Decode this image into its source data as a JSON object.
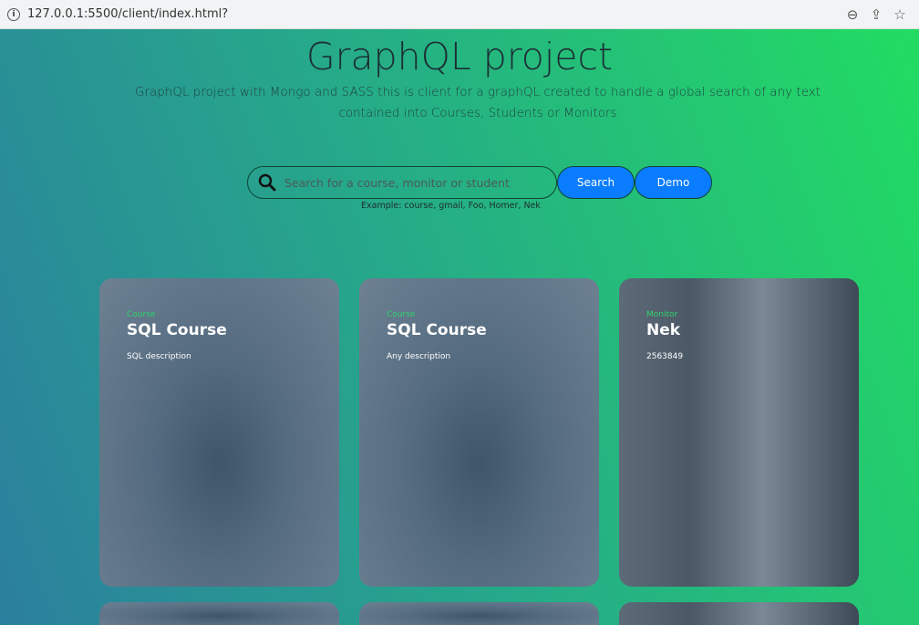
{
  "browser": {
    "url": "127.0.0.1:5500/client/index.html?"
  },
  "header": {
    "title": "GraphQL project",
    "subtitle": "GraphQL project with Mongo and SASS this is client for a graphQL created to handle a global search of any text contained into Courses, Students or Monitors"
  },
  "search": {
    "placeholder": "Search for a course, monitor or student",
    "value": "",
    "search_label": "Search",
    "demo_label": "Demo",
    "example": "Example: course, gmail, Foo, Homer, Nek"
  },
  "cards": [
    {
      "type": "Course",
      "title": "SQL Course",
      "description": "SQL description"
    },
    {
      "type": "Course",
      "title": "SQL Course",
      "description": "Any description"
    },
    {
      "type": "Monitor",
      "title": "Nek",
      "description": "2563849"
    }
  ]
}
